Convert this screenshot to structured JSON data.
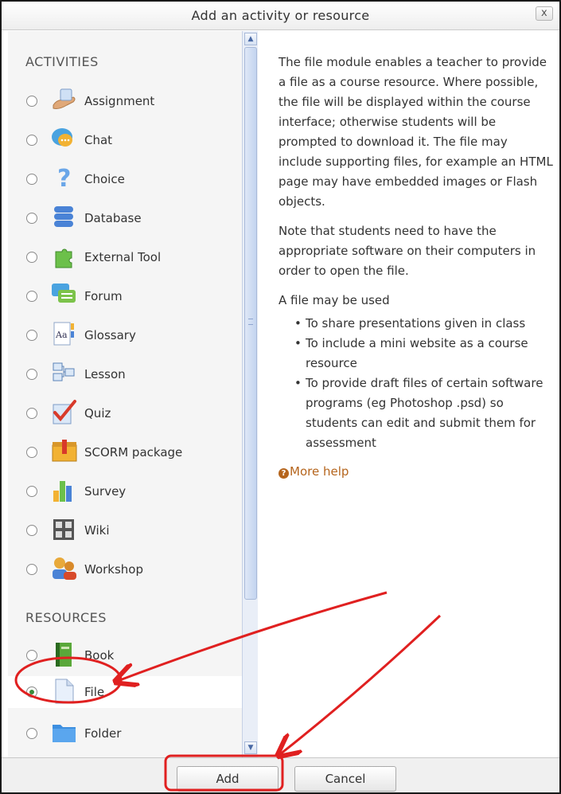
{
  "dialog": {
    "title": "Add an activity or resource",
    "close_label": "x"
  },
  "activities": {
    "heading": "ACTIVITIES",
    "items": [
      {
        "label": "Assignment",
        "icon": "assignment-icon"
      },
      {
        "label": "Chat",
        "icon": "chat-icon"
      },
      {
        "label": "Choice",
        "icon": "choice-icon"
      },
      {
        "label": "Database",
        "icon": "database-icon"
      },
      {
        "label": "External Tool",
        "icon": "external-tool-icon"
      },
      {
        "label": "Forum",
        "icon": "forum-icon"
      },
      {
        "label": "Glossary",
        "icon": "glossary-icon"
      },
      {
        "label": "Lesson",
        "icon": "lesson-icon"
      },
      {
        "label": "Quiz",
        "icon": "quiz-icon"
      },
      {
        "label": "SCORM package",
        "icon": "scorm-package-icon"
      },
      {
        "label": "Survey",
        "icon": "survey-icon"
      },
      {
        "label": "Wiki",
        "icon": "wiki-icon"
      },
      {
        "label": "Workshop",
        "icon": "workshop-icon"
      }
    ]
  },
  "resources": {
    "heading": "RESOURCES",
    "items": [
      {
        "label": "Book",
        "icon": "book-icon",
        "selected": false
      },
      {
        "label": "File",
        "icon": "file-icon",
        "selected": true
      },
      {
        "label": "Folder",
        "icon": "folder-icon",
        "selected": false
      }
    ]
  },
  "description": {
    "para1": "The file module enables a teacher to provide a file as a course resource. Where possible, the file will be displayed within the course interface; otherwise students will be prompted to download it. The file may include supporting files, for example an HTML page may have embedded images or Flash objects.",
    "para2": "Note that students need to have the appropriate software on their computers in order to open the file.",
    "para3": "A file may be used",
    "bullets": [
      "To share presentations given in class",
      "To include a mini website as a course resource",
      "To provide draft files of certain software programs (eg Photoshop .psd) so students can edit and submit them for assessment"
    ],
    "more_help": "More help"
  },
  "footer": {
    "add_label": "Add",
    "cancel_label": "Cancel"
  },
  "colors": {
    "annotation": "#e02020",
    "link": "#b5651d",
    "radio_checked": "#3a8a3a"
  }
}
